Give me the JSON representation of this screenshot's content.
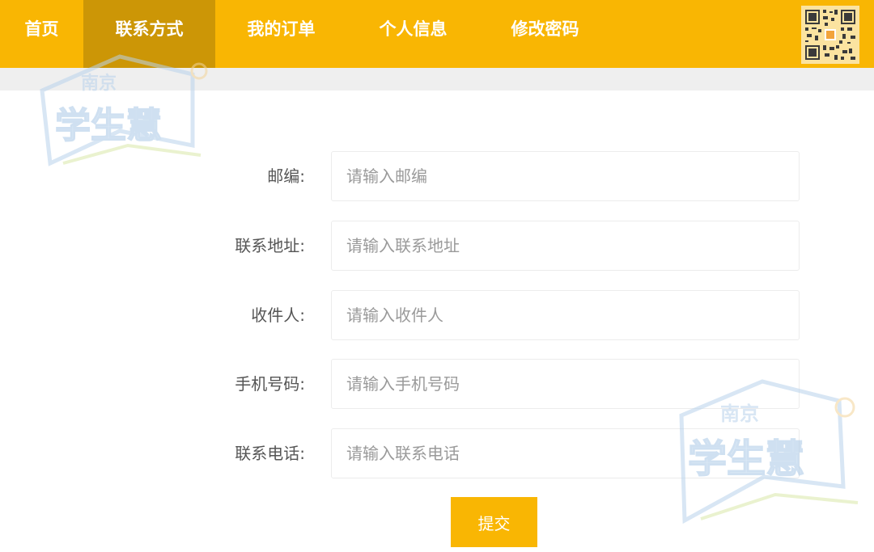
{
  "colors": {
    "accent": "#f9b603",
    "active_tab": "#cc9606",
    "watermark": "#b9d3ec"
  },
  "nav": {
    "items": [
      {
        "label": "首页"
      },
      {
        "label": "联系方式"
      },
      {
        "label": "我的订单"
      },
      {
        "label": "个人信息"
      },
      {
        "label": "修改密码"
      }
    ],
    "active_index": 1,
    "qr_icon": "qr-code-icon"
  },
  "form": {
    "fields": [
      {
        "label": "邮编:",
        "placeholder": "请输入邮编",
        "value": ""
      },
      {
        "label": "联系地址:",
        "placeholder": "请输入联系地址",
        "value": ""
      },
      {
        "label": "收件人:",
        "placeholder": "请输入收件人",
        "value": ""
      },
      {
        "label": "手机号码:",
        "placeholder": "请输入手机号码",
        "value": ""
      },
      {
        "label": "联系电话:",
        "placeholder": "请输入联系电话",
        "value": ""
      }
    ],
    "submit_label": "提交"
  },
  "watermark": {
    "line1": "南京",
    "line2": "学生慧"
  }
}
